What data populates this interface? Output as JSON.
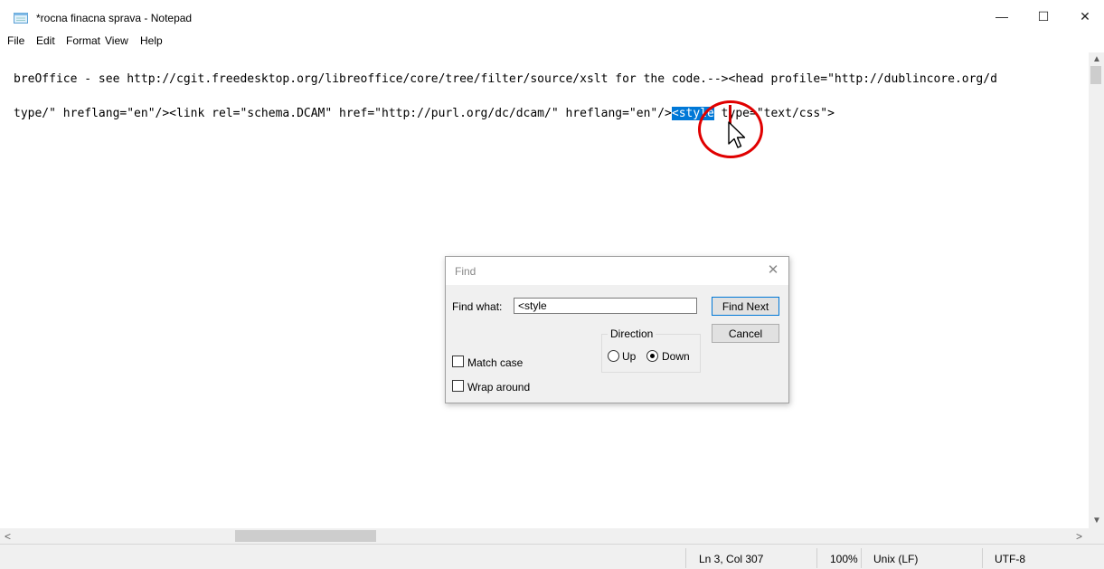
{
  "window": {
    "title": "*rocna finacna sprava - Notepad",
    "controls": {
      "minimize": "—",
      "maximize": "☐",
      "close": "✕"
    }
  },
  "menu": [
    "File",
    "Edit",
    "Format",
    "View",
    "Help"
  ],
  "editor": {
    "line1": "breOffice - see http://cgit.freedesktop.org/libreoffice/core/tree/filter/source/xslt for the code.--><head profile=\"http://dublincore.org/d",
    "line2_before": "type/\" hreflang=\"en\"/><link rel=\"schema.DCAM\" href=\"http://purl.org/dc/dcam/\" hreflang=\"en\"/>",
    "line2_selected": "<style",
    "line2_after": " type=\"text/css\">"
  },
  "status": {
    "position": "Ln 3, Col 307",
    "zoom": "100%",
    "line_ending": "Unix (LF)",
    "encoding": "UTF-8"
  },
  "find_dialog": {
    "title": "Find",
    "find_what_label": "Find what:",
    "find_what_value": "<style",
    "find_next": "Find Next",
    "cancel": "Cancel",
    "direction_label": "Direction",
    "up_label": "Up",
    "down_label": "Down",
    "direction_selected": "Down",
    "match_case_label": "Match case",
    "match_case_checked": false,
    "wrap_around_label": "Wrap around",
    "wrap_around_checked": false
  },
  "colors": {
    "selection": "#0078d7",
    "annotation": "#e00000"
  }
}
